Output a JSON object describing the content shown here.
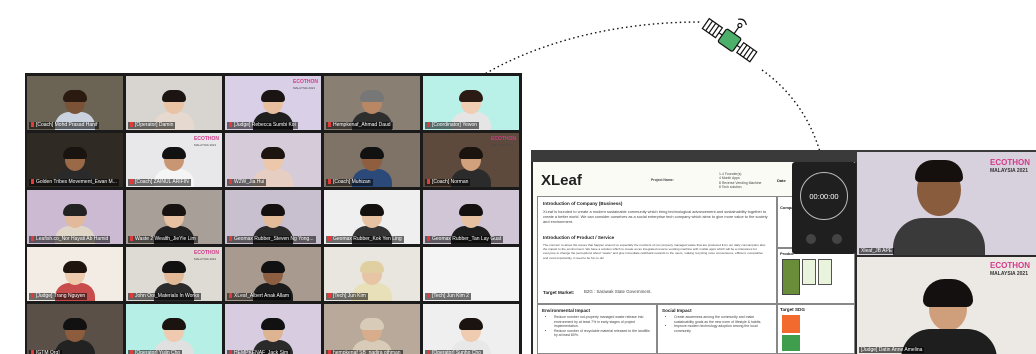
{
  "gallery": {
    "tiles": [
      {
        "label": "[Coach] Mohd Prasad Hanif",
        "bg": "#6b6455",
        "skin": "#7a5236",
        "hair": "#2a1a10",
        "shirt": "#c9d2de",
        "logo": false,
        "active": false
      },
      {
        "label": "[Operator] Damin",
        "bg": "#d8d4cf",
        "skin": "#e9c3a4",
        "hair": "#1b1412",
        "shirt": "#e6d9cf",
        "logo": false,
        "active": false
      },
      {
        "label": "[Judge] Rebecca Sumbi Koi",
        "bg": "#d9cfe6",
        "skin": "#e8c0a0",
        "hair": "#1a1512",
        "shirt": "#1f1f1f",
        "logo": true,
        "active": false
      },
      {
        "label": "Hempkenaf_Ahmad Daud",
        "bg": "#8a7f73",
        "skin": "#b98764",
        "hair": "#777",
        "shirt": "#2e2e2e",
        "logo": false,
        "active": false
      },
      {
        "label": "[Coordinator] Yewon",
        "bg": "#b9f0e8",
        "skin": "#f0cdb3",
        "hair": "#2b1b14",
        "shirt": "#e5e5e5",
        "logo": false,
        "active": true
      },
      {
        "label": "Golden Tribes Movement_Ewan M...",
        "bg": "#302a25",
        "skin": "#9a6a48",
        "hair": "#1a1410",
        "shirt": "#2a2a2a",
        "logo": false,
        "active": false
      },
      {
        "label": "[Coach] ZAINUL ARIFIN",
        "bg": "#e8e8ea",
        "skin": "#c89673",
        "hair": "#111",
        "shirt": "#f5f5f5",
        "logo": true,
        "active": false
      },
      {
        "label": "W2W_Jia Hui",
        "bg": "#d6ccd9",
        "skin": "#edc7aa",
        "hair": "#1d1410",
        "shirt": "#e6cfc2",
        "logo": false,
        "active": false
      },
      {
        "label": "[Coach] Muhizan",
        "bg": "#7f7266",
        "skin": "#8e5e3e",
        "hair": "#111",
        "shirt": "#2b4a7a",
        "logo": false,
        "active": false
      },
      {
        "label": "[Coach] Norman",
        "bg": "#5e4a3c",
        "skin": "#d1a07c",
        "hair": "#1b130e",
        "shirt": "#2b2b2b",
        "logo": true,
        "active": false
      },
      {
        "label": "Leafish.co_Nor Hayati Ab Hamid",
        "bg": "#cbbad2",
        "skin": "#e2b99a",
        "hair": "#222",
        "shirt": "#e0d6c8",
        "logo": false,
        "active": false
      },
      {
        "label": "Waste 2 Wealth_JieYie Lim",
        "bg": "#a79f98",
        "skin": "#e8c0a2",
        "hair": "#171210",
        "shirt": "#222",
        "logo": false,
        "active": false
      },
      {
        "label": "Geomax Rubber_Steven Ng Yong...",
        "bg": "#c9c0cf",
        "skin": "#e3bb99",
        "hair": "#151010",
        "shirt": "#2a2a2a",
        "logo": false,
        "active": false
      },
      {
        "label": "Geomax Rubber_Kok Yen Ling",
        "bg": "#efefef",
        "skin": "#e6c1a2",
        "hair": "#141010",
        "shirt": "#333",
        "logo": false,
        "active": false
      },
      {
        "label": "Geomax Rubber_Tan Lay Guat",
        "bg": "#d0c6d6",
        "skin": "#e6c0a0",
        "hair": "#141010",
        "shirt": "#1e1e1e",
        "logo": false,
        "active": false
      },
      {
        "label": "[Judge] Trang Nguyen",
        "bg": "#f2ece4",
        "skin": "#eecbad",
        "hair": "#20140f",
        "shirt": "#c94c4c",
        "logo": false,
        "active": false
      },
      {
        "label": "John Ooi_Materials In Works",
        "bg": "#dedad4",
        "skin": "#e2b996",
        "hair": "#111",
        "shirt": "#2b2b2b",
        "logo": true,
        "active": false
      },
      {
        "label": "XLeaf_Albert Anak Allam",
        "bg": "#a89a8e",
        "skin": "#8d5f40",
        "hair": "#111",
        "shirt": "#1c1c1c",
        "logo": false,
        "active": false
      },
      {
        "label": "[Tech] Jun Kim",
        "bg": "#e9e6df",
        "skin": "#e7c4a4",
        "hair": "#e0cfa0",
        "shirt": "#e8e0b8",
        "logo": false,
        "active": false
      },
      {
        "label": "[Tech] Jun Kim 2",
        "bg": "#f4f4f4",
        "skin": "#f4f4f4",
        "hair": "#f4f4f4",
        "shirt": "#f4f4f4",
        "logo": false,
        "active": false
      },
      {
        "label": "[GTM Org]",
        "bg": "#5a5048",
        "skin": "#8c5c3c",
        "hair": "#111",
        "shirt": "#222",
        "logo": false,
        "active": false
      },
      {
        "label": "[Operator] Yujin Cho",
        "bg": "#b6efe5",
        "skin": "#efcaae",
        "hair": "#1b130f",
        "shirt": "#e0e0e0",
        "logo": false,
        "active": false
      },
      {
        "label": "HEMPKENAF_Jack Sim",
        "bg": "#d7cce0",
        "skin": "#deb392",
        "hair": "#111",
        "shirt": "#2a2a2a",
        "logo": false,
        "active": false
      },
      {
        "label": "hempkenaf SB_nadira othman",
        "bg": "#b8a99a",
        "skin": "#d7ad8c",
        "hair": "#d8cbb7",
        "shirt": "#d8cbb7",
        "logo": false,
        "active": false
      },
      {
        "label": "[Operator] Sunho Cho",
        "bg": "#efefef",
        "skin": "#efcbb0",
        "hair": "#1b130f",
        "shirt": "#e8e8e8",
        "logo": false,
        "active": false
      }
    ],
    "logo_text": "ECOTHON",
    "logo_sub": "MALAYSIA 2021"
  },
  "share": {
    "slide": {
      "title": "XLeaf",
      "project_name_label": "Project Name:",
      "date_label": "Date",
      "team_lines": [
        "1-4 Founder(s)",
        "4 Month Apps",
        "8 Reverse Vending Machine",
        "8 Tech solution"
      ],
      "company_heading": "Introduction of Company (Business)",
      "company_text": "XLeaf is founded to create a modern sustainable community which bring technological advancement and sustainability together to create a better world. We can consider ourselves as a social enterprise tech company which aims to give more value to the society and environment.",
      "product_heading": "Introduction of Product / Service",
      "product_text": "The concern to about the issues that happen around us especially the numbers of non property managed waste that are produced from our daily consumption also the impact to the environment. We have a solution which to create an an integrated reverse vending machine with mobile apps which will be a milestones for everyone to change the perceptions about \"waste\" and give immediate cashback rewards to the users, making recycling more convenience, efficient, competitive and most importantly, it need to be fun to do!",
      "target_market_label": "Target Market:",
      "target_market_value": "B2G : Sarawak State Government.",
      "env_heading": "Environmental Impact",
      "env_items": [
        "Reduce number not-property managed waste release into environment by at least 7% in early stages of project implementation.",
        "Reduce number of recyclable material released to the landfills by at least 80%."
      ],
      "social_heading": "Social Impact",
      "social_items": [
        "Create awareness among the community and make sustainability goals as the new norm of lifestyle & habits.",
        "Improve modern technology adoption among the local community"
      ],
      "company_side": "Compan",
      "product_side": "Produc",
      "sdg_heading": "Target SDG"
    },
    "timer": "00:00:00",
    "cams": [
      {
        "label": "Xleaf_JB APE"
      },
      {
        "label": "[Judge] Datin Anne Amelina"
      }
    ]
  },
  "colors": {
    "gallery_bg": "#1b1b1b",
    "active_border": "#f5d63a",
    "logo_pink": "#d23a8a",
    "sdg_orange": "#f26a2d"
  },
  "icons": [
    "satellite-icon",
    "mic-muted-icon",
    "timer-icon"
  ]
}
